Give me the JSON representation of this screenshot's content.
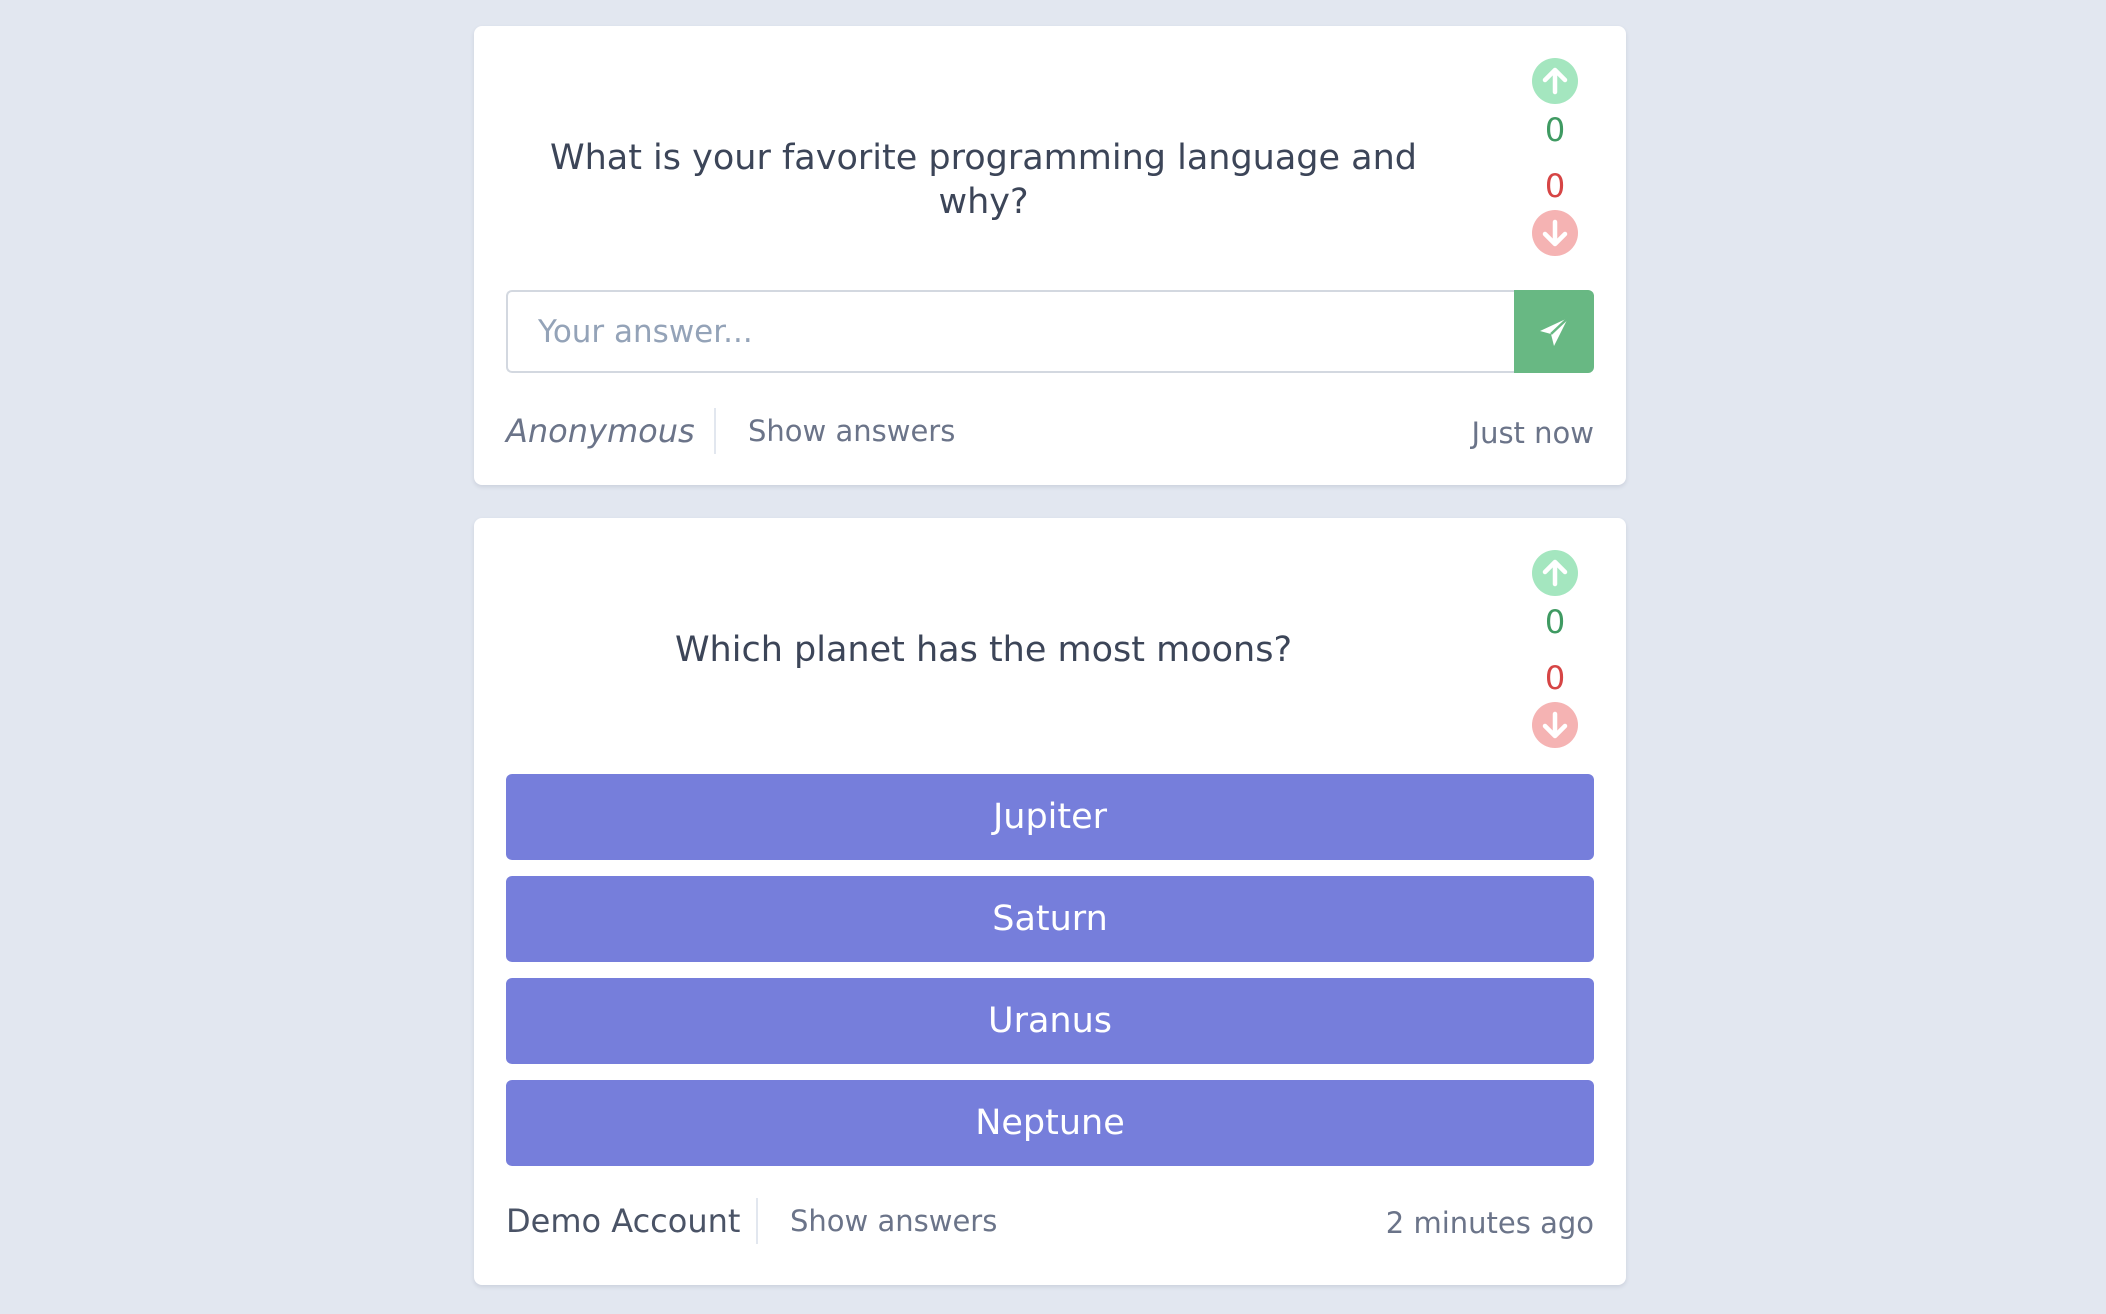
{
  "questions": [
    {
      "text": "What is your favorite programming language and why?",
      "upvotes": "0",
      "downvotes": "0",
      "answer_placeholder": "Your answer...",
      "author": "Anonymous",
      "show_answers_label": "Show answers",
      "timestamp": "Just now"
    },
    {
      "text": "Which planet has the most moons?",
      "upvotes": "0",
      "downvotes": "0",
      "options": [
        "Jupiter",
        "Saturn",
        "Uranus",
        "Neptune"
      ],
      "author": "Demo Account",
      "show_answers_label": "Show answers",
      "timestamp": "2 minutes ago"
    }
  ],
  "icons": {
    "upvote": "arrow-up-circle-icon",
    "downvote": "arrow-down-circle-icon",
    "send": "paper-plane-icon"
  },
  "colors": {
    "background": "#e2e7f0",
    "upvote": "#a4e6bf",
    "upvote_count": "#3f9a62",
    "downvote": "#f5b3b3",
    "downvote_count": "#d64545",
    "send_button": "#68b883",
    "option_button": "#767edb"
  }
}
